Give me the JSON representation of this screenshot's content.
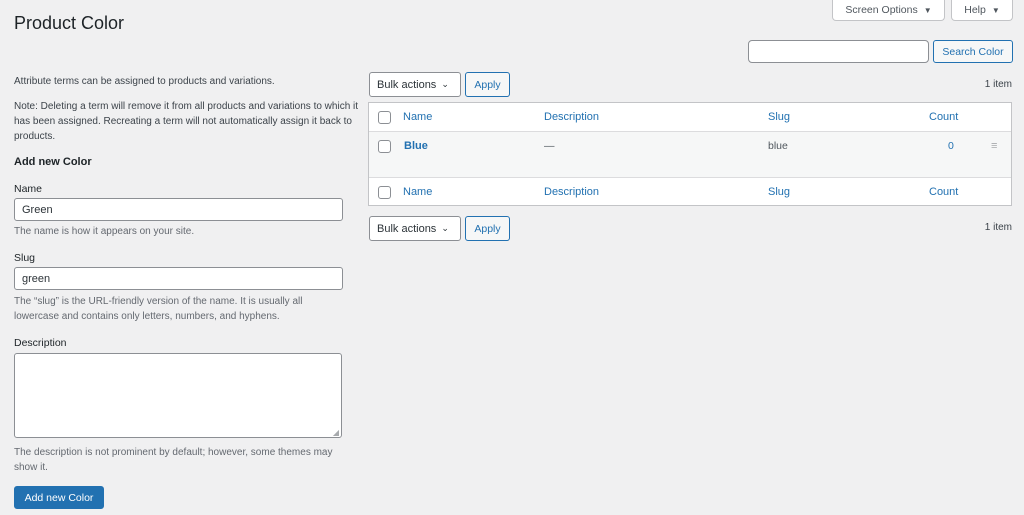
{
  "header": {
    "title": "Product Color",
    "screen_options": "Screen Options",
    "help": "Help",
    "dropdown_icon": "triangle-down-icon"
  },
  "search": {
    "value": "",
    "placeholder": "",
    "button": "Search Color"
  },
  "form": {
    "intro": "Attribute terms can be assigned to products and variations.",
    "note": "Note: Deleting a term will remove it from all products and variations to which it has been assigned. Recreating a term will not automatically assign it back to products.",
    "heading": "Add new Color",
    "name": {
      "label": "Name",
      "value": "Green",
      "help": "The name is how it appears on your site."
    },
    "slug": {
      "label": "Slug",
      "value": "green",
      "help": "The “slug” is the URL-friendly version of the name. It is usually all lowercase and contains only letters, numbers, and hyphens."
    },
    "description": {
      "label": "Description",
      "value": "",
      "help": "The description is not prominent by default; however, some themes may show it."
    },
    "submit": "Add new Color"
  },
  "list": {
    "bulk_actions": "Bulk actions",
    "apply": "Apply",
    "item_count": "1 item",
    "columns": {
      "name": "Name",
      "description": "Description",
      "slug": "Slug",
      "count": "Count"
    },
    "rows": [
      {
        "name": "Blue",
        "description": "—",
        "slug": "blue",
        "count": "0",
        "handle_icon": "drag-handle-icon"
      }
    ]
  }
}
